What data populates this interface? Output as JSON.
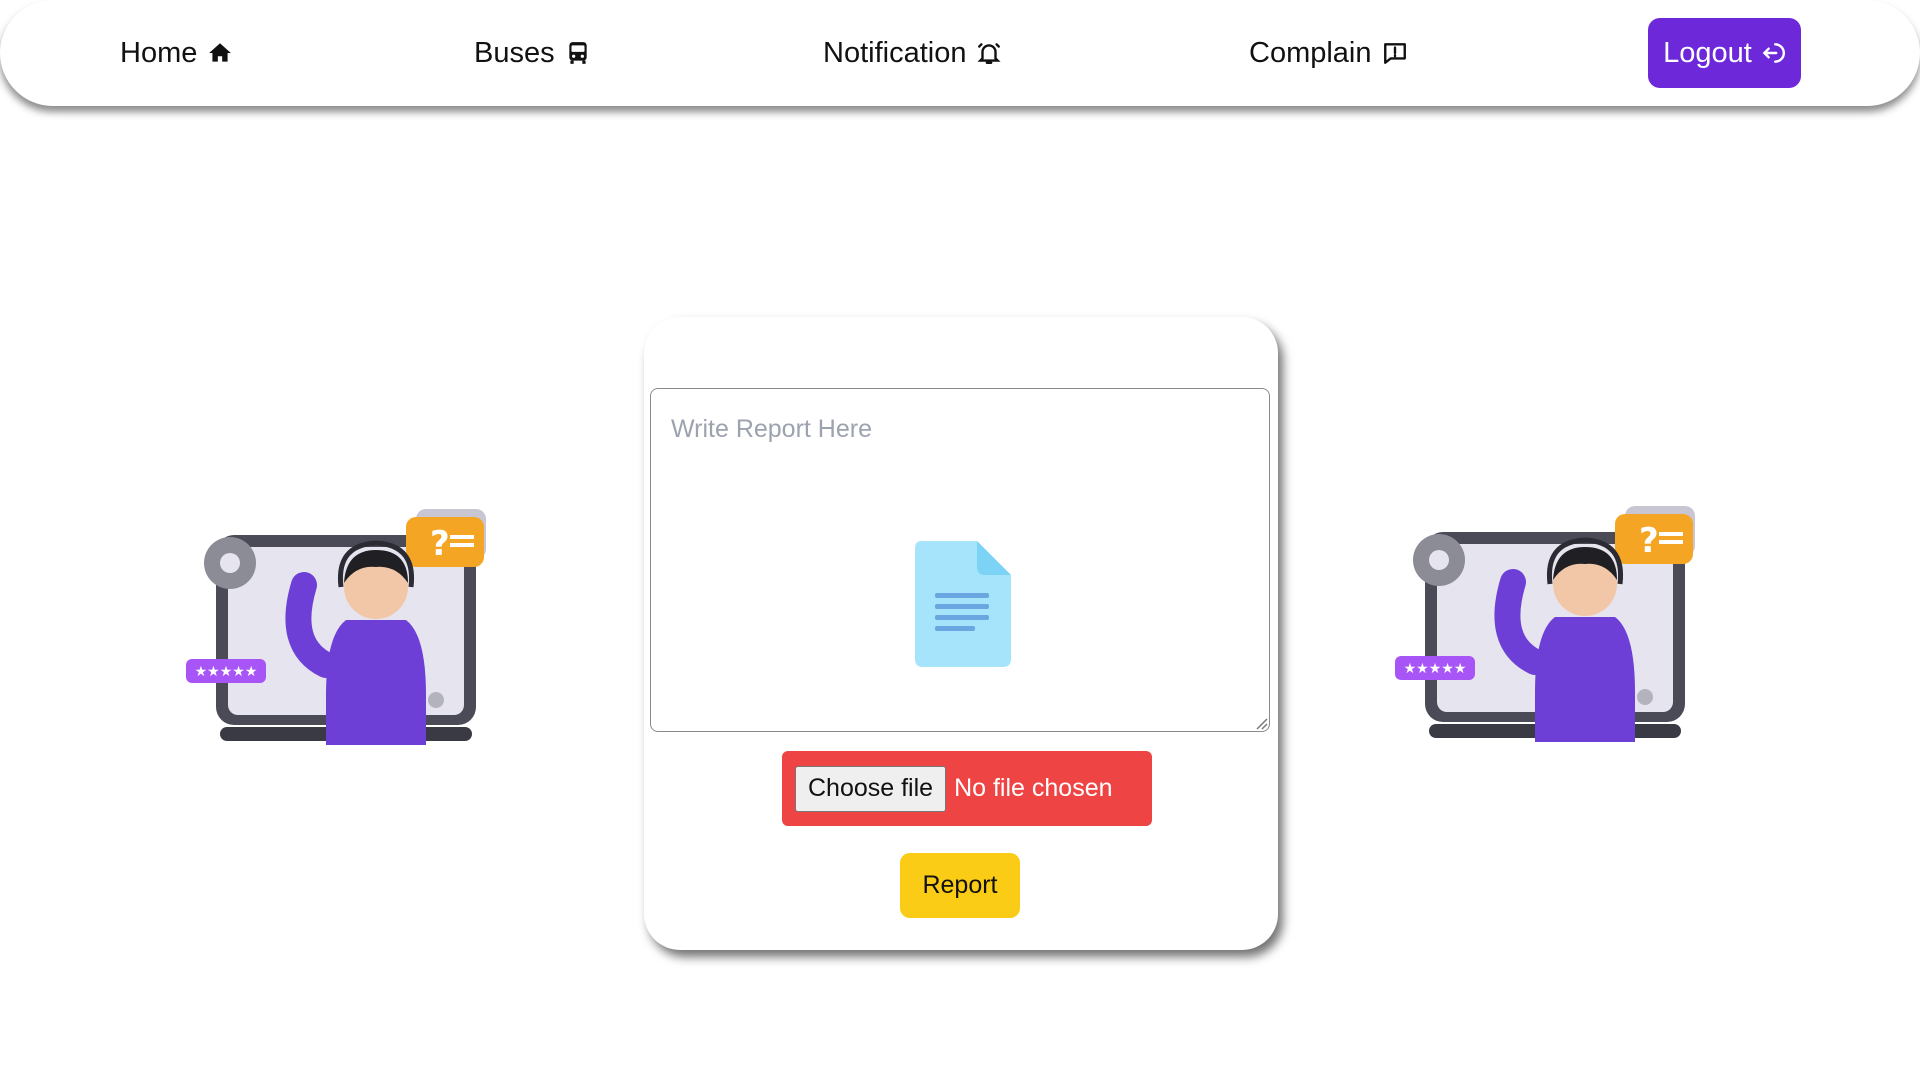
{
  "nav": {
    "home": {
      "label": "Home",
      "icon": "home-icon"
    },
    "buses": {
      "label": "Buses",
      "icon": "bus-icon"
    },
    "notification": {
      "label": "Notification",
      "icon": "bell-icon"
    },
    "complain": {
      "label": "Complain",
      "icon": "chat-alert-icon"
    },
    "logout": {
      "label": "Logout",
      "icon": "logout-icon"
    }
  },
  "form": {
    "report_placeholder": "Write Report Here",
    "choose_file_label": "Choose file",
    "file_status": "No file chosen",
    "submit_label": "Report"
  },
  "colors": {
    "logout_bg": "#6d28d9",
    "file_input_bg": "#ef4444",
    "report_button_bg": "#facc15",
    "placeholder_text": "#9ca3af"
  }
}
